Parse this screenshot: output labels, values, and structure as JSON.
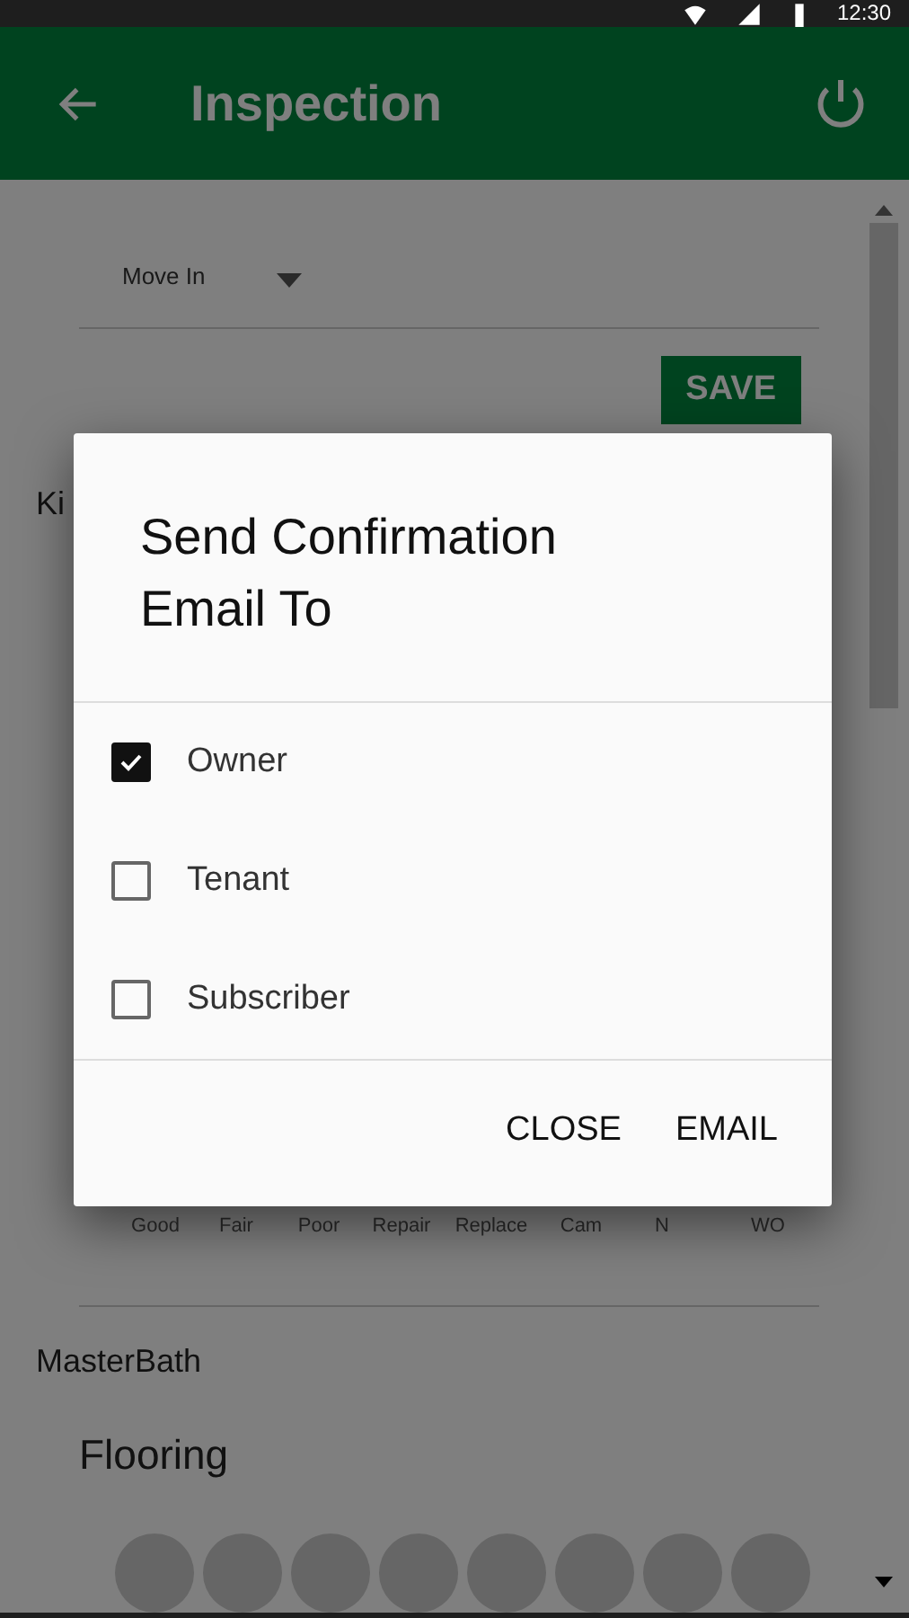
{
  "status_bar": {
    "time": "12:30"
  },
  "app_bar": {
    "title": "Inspection"
  },
  "inspection_type": {
    "value": "Move In"
  },
  "save_button": "SAVE",
  "rooms": [
    {
      "name": "Ki",
      "rating_labels": [
        "Good",
        "Fair",
        "Poor",
        "Repair",
        "Replace",
        "Cam",
        "N",
        "WO"
      ]
    },
    {
      "name": "MasterBath",
      "items": [
        {
          "name": "Flooring"
        }
      ]
    }
  ],
  "dialog": {
    "title": "Send Confirmation Email To",
    "options": [
      {
        "label": "Owner",
        "checked": true
      },
      {
        "label": "Tenant",
        "checked": false
      },
      {
        "label": "Subscriber",
        "checked": false
      }
    ],
    "buttons": [
      "CLOSE",
      "EMAIL"
    ]
  }
}
